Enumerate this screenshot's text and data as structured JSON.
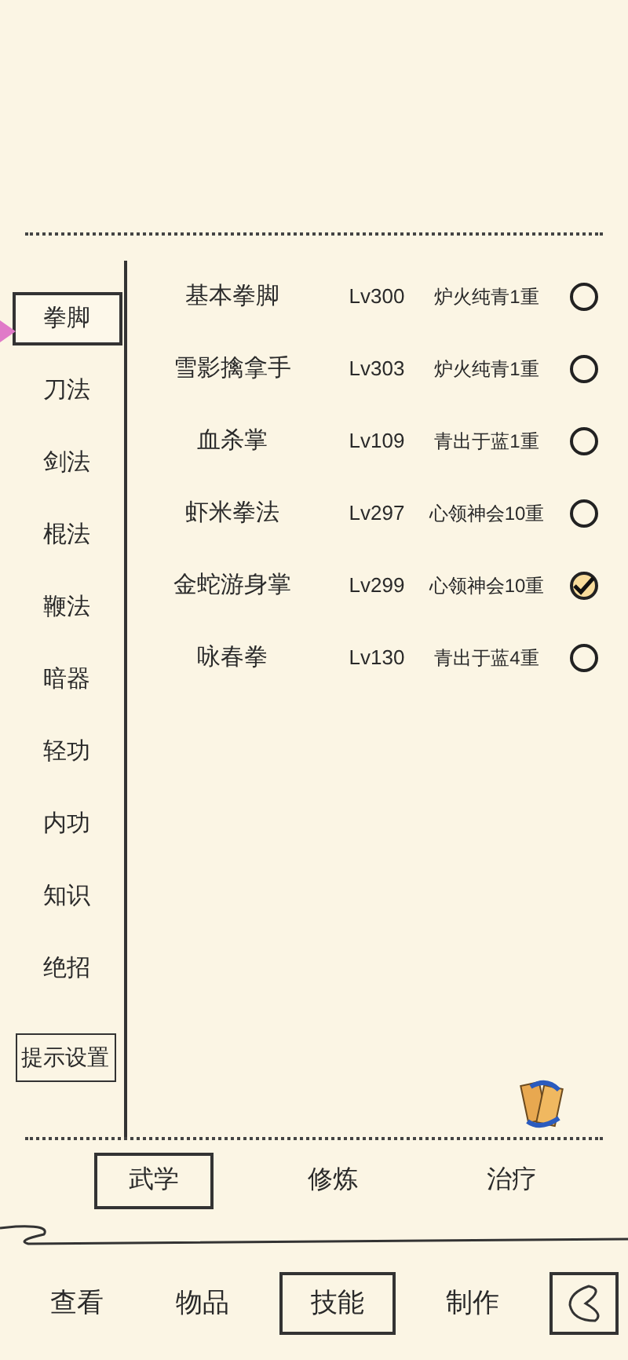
{
  "categories": [
    {
      "label": "拳脚",
      "selected": true
    },
    {
      "label": "刀法",
      "selected": false
    },
    {
      "label": "剑法",
      "selected": false
    },
    {
      "label": "棍法",
      "selected": false
    },
    {
      "label": "鞭法",
      "selected": false
    },
    {
      "label": "暗器",
      "selected": false
    },
    {
      "label": "轻功",
      "selected": false
    },
    {
      "label": "内功",
      "selected": false
    },
    {
      "label": "知识",
      "selected": false
    },
    {
      "label": "绝招",
      "selected": false
    }
  ],
  "hint_settings": "提示设置",
  "skills": [
    {
      "name": "基本拳脚",
      "level": "Lv300",
      "stage": "炉火纯青1重",
      "checked": false
    },
    {
      "name": "雪影擒拿手",
      "level": "Lv303",
      "stage": "炉火纯青1重",
      "checked": false
    },
    {
      "name": "血杀掌",
      "level": "Lv109",
      "stage": "青出于蓝1重",
      "checked": false
    },
    {
      "name": "虾米拳法",
      "level": "Lv297",
      "stage": "心领神会10重",
      "checked": false
    },
    {
      "name": "金蛇游身掌",
      "level": "Lv299",
      "stage": "心领神会10重",
      "checked": true
    },
    {
      "name": "咏春拳",
      "level": "Lv130",
      "stage": "青出于蓝4重",
      "checked": false
    }
  ],
  "sub_tabs": [
    {
      "label": "武学",
      "selected": true
    },
    {
      "label": "修炼",
      "selected": false
    },
    {
      "label": "治疗",
      "selected": false
    }
  ],
  "bottom_nav": [
    {
      "label": "查看",
      "selected": false
    },
    {
      "label": "物品",
      "selected": false
    },
    {
      "label": "技能",
      "selected": true
    },
    {
      "label": "制作",
      "selected": false
    }
  ]
}
